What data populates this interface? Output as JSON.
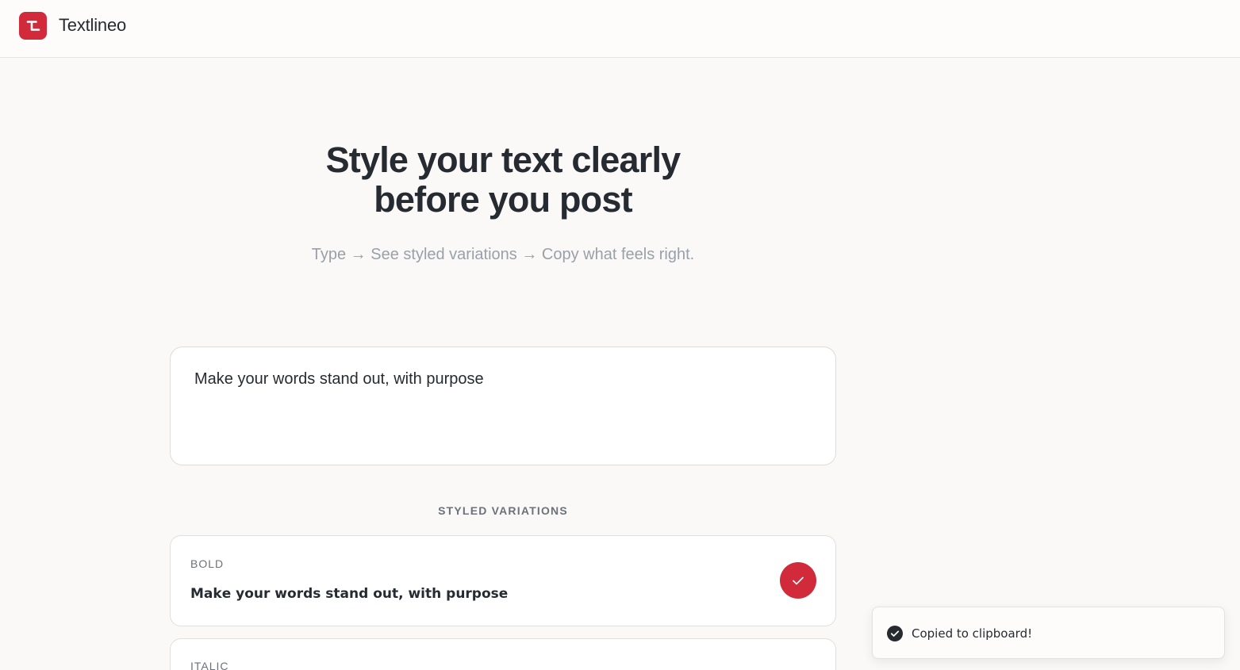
{
  "header": {
    "brand": "Textlineo",
    "logo_icon": "textlineo-logo-icon"
  },
  "hero": {
    "title_line1": "Style your text clearly",
    "title_line2": "before you post",
    "subtitle": "Type → See styled variations → Copy what feels right."
  },
  "input": {
    "value": "Make your words stand out, with purpose"
  },
  "variations": {
    "heading": "STYLED VARIATIONS",
    "items": [
      {
        "label": "BOLD",
        "text": "𝗠𝗮𝗸𝗲 𝘆𝗼𝘂𝗿 𝘄𝗼𝗿𝗱𝘀 𝘀𝘁𝗮𝗻𝗱 𝗼𝘂𝘁, 𝘄𝗶𝘁𝗵 𝗽𝘂𝗿𝗽𝗼𝘀𝗲",
        "copied": true,
        "button_icon": "check-icon"
      },
      {
        "label": "ITALIC"
      }
    ]
  },
  "toast": {
    "message": "Copied to clipboard!",
    "icon": "check-circle-icon"
  },
  "colors": {
    "accent": "#d12a3a",
    "text": "#262b32",
    "muted": "#9aa0a8",
    "background": "#faf9f8"
  }
}
